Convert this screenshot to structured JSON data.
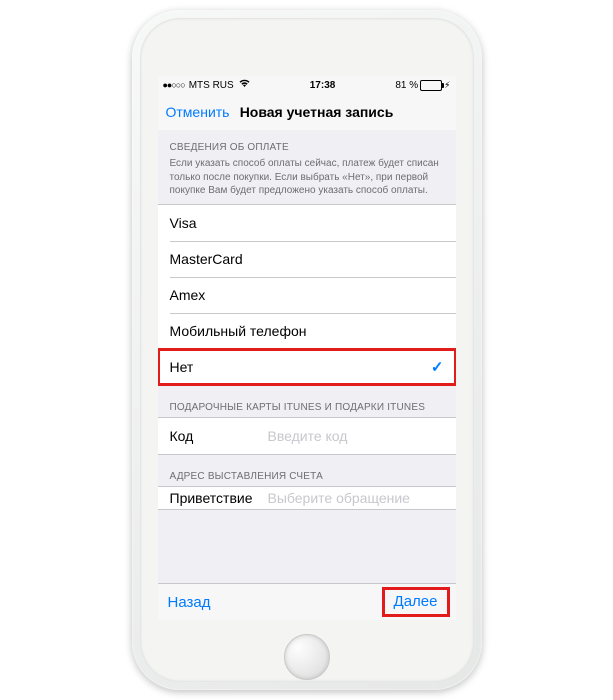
{
  "status_bar": {
    "carrier": "MTS RUS",
    "time": "17:38",
    "battery_pct": "81 %",
    "battery_fill_pct": 81
  },
  "nav": {
    "cancel": "Отменить",
    "title": "Новая учетная запись"
  },
  "payment": {
    "header": "СВЕДЕНИЯ ОБ ОПЛАТЕ",
    "description": "Если указать способ оплаты сейчас, платеж будет списан только после покупки. Если выбрать «Нет», при первой покупке Вам будет предложено указать способ оплаты.",
    "options": {
      "visa": "Visa",
      "mastercard": "MasterCard",
      "amex": "Amex",
      "mobile": "Мобильный телефон",
      "none": "Нет"
    }
  },
  "gift": {
    "header": "ПОДАРОЧНЫЕ КАРТЫ ITUNES И ПОДАРКИ ITUNES",
    "code_label": "Код",
    "code_placeholder": "Введите код"
  },
  "billing": {
    "header": "АДРЕС ВЫСТАВЛЕНИЯ СЧЕТА",
    "salutation_label": "Приветствие",
    "salutation_placeholder": "Выберите обращение"
  },
  "footer": {
    "back": "Назад",
    "next": "Далее"
  }
}
